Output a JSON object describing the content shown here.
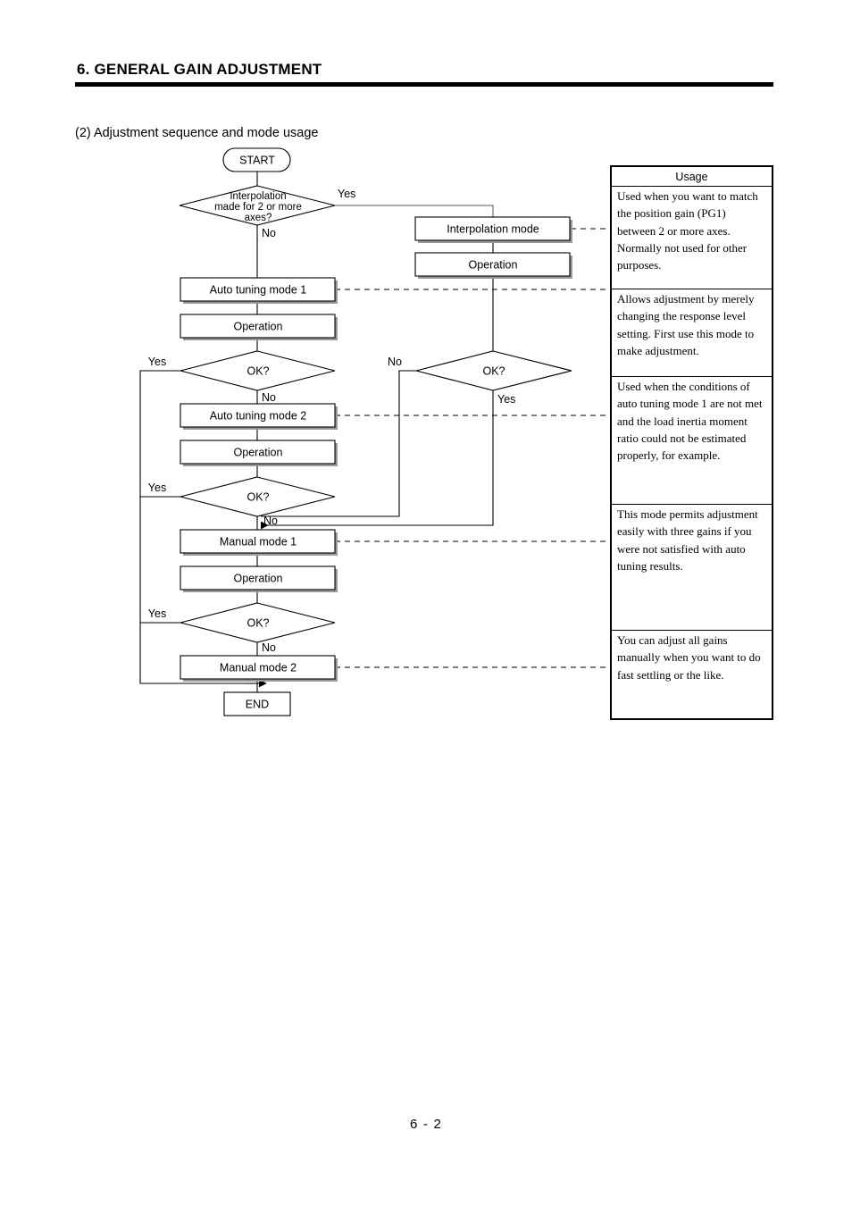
{
  "header": {
    "chapter_title": "6. GENERAL GAIN ADJUSTMENT"
  },
  "section": {
    "caption": "(2) Adjustment sequence and mode usage"
  },
  "flowchart": {
    "nodes": {
      "start": "START",
      "decision_interpolation_l1": "Interpolation",
      "decision_interpolation_l2": "made for 2 or more",
      "decision_interpolation_l3": "axes?",
      "interpolation_mode": "Interpolation mode",
      "operation_interp": "Operation",
      "auto_tuning_1": "Auto tuning mode 1",
      "operation_at1": "Operation",
      "ok_at1": "OK?",
      "ok_right": "OK?",
      "auto_tuning_2": "Auto tuning mode 2",
      "operation_at2": "Operation",
      "ok_at2": "OK?",
      "manual_mode_1": "Manual mode 1",
      "operation_mm1": "Operation",
      "ok_mm1": "OK?",
      "manual_mode_2": "Manual mode 2",
      "end": "END"
    },
    "branches": {
      "interp_yes": "Yes",
      "interp_no": "No",
      "at1_yes": "Yes",
      "at1_no": "No",
      "right_no": "No",
      "right_yes": "Yes",
      "at2_yes": "Yes",
      "at2_no": "No",
      "mm1_yes": "Yes",
      "mm1_no": "No"
    }
  },
  "usage_table": {
    "header": "Usage",
    "rows": [
      "Used when you want to match the position gain (PG1) between 2 or more axes. Normally not used for other purposes.",
      "Allows adjustment by merely changing the response level setting. First use this mode to make adjustment.",
      "Used when the conditions of auto tuning mode 1 are not met and the load inertia moment ratio could not be estimated properly, for example.",
      "This mode permits adjustment easily with three gains if you were not satisfied with auto tuning results.",
      "You can adjust all gains manually when you want to do fast settling or the like."
    ]
  },
  "footer": {
    "page_number": "6 -  2"
  }
}
